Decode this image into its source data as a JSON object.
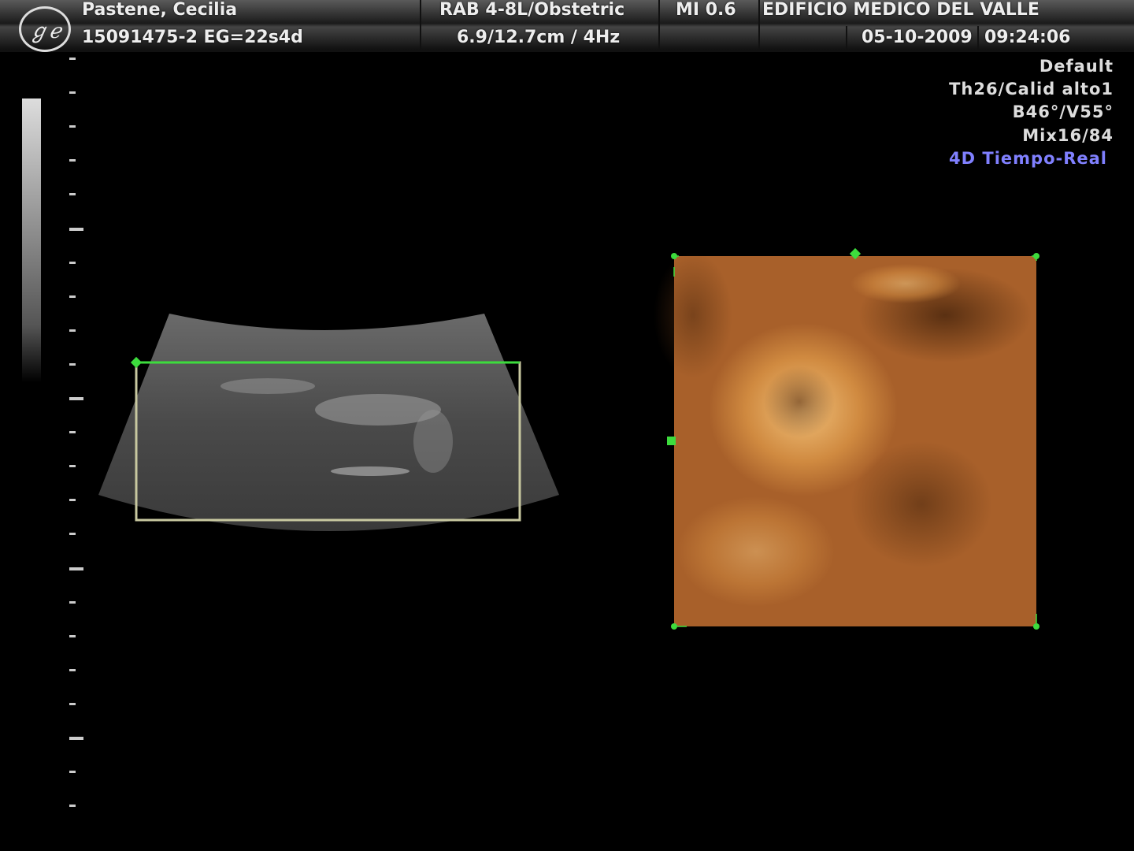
{
  "header": {
    "logo": "GE",
    "patient_name": "Pastene, Cecilia",
    "patient_id_ga": "15091475-2  EG=22s4d",
    "probe_preset": "RAB 4-8L/Obstetric",
    "depth_freq": "6.9/12.7cm /  4Hz",
    "mi": "MI  0.6",
    "institution": "EDIFICIO MEDICO DEL VALLE",
    "date": "05-10-2009",
    "time": "09:24:06"
  },
  "parameters": {
    "preset": "Default",
    "quality": "Th26/Calid alto1",
    "angles": "B46°/V55°",
    "mix": "Mix16/84",
    "mode": "4D Tiempo-Real"
  },
  "colors": {
    "accent_green": "#3ddc3d",
    "mode_blue": "#8080ff",
    "render_orange": "#c97a35"
  }
}
